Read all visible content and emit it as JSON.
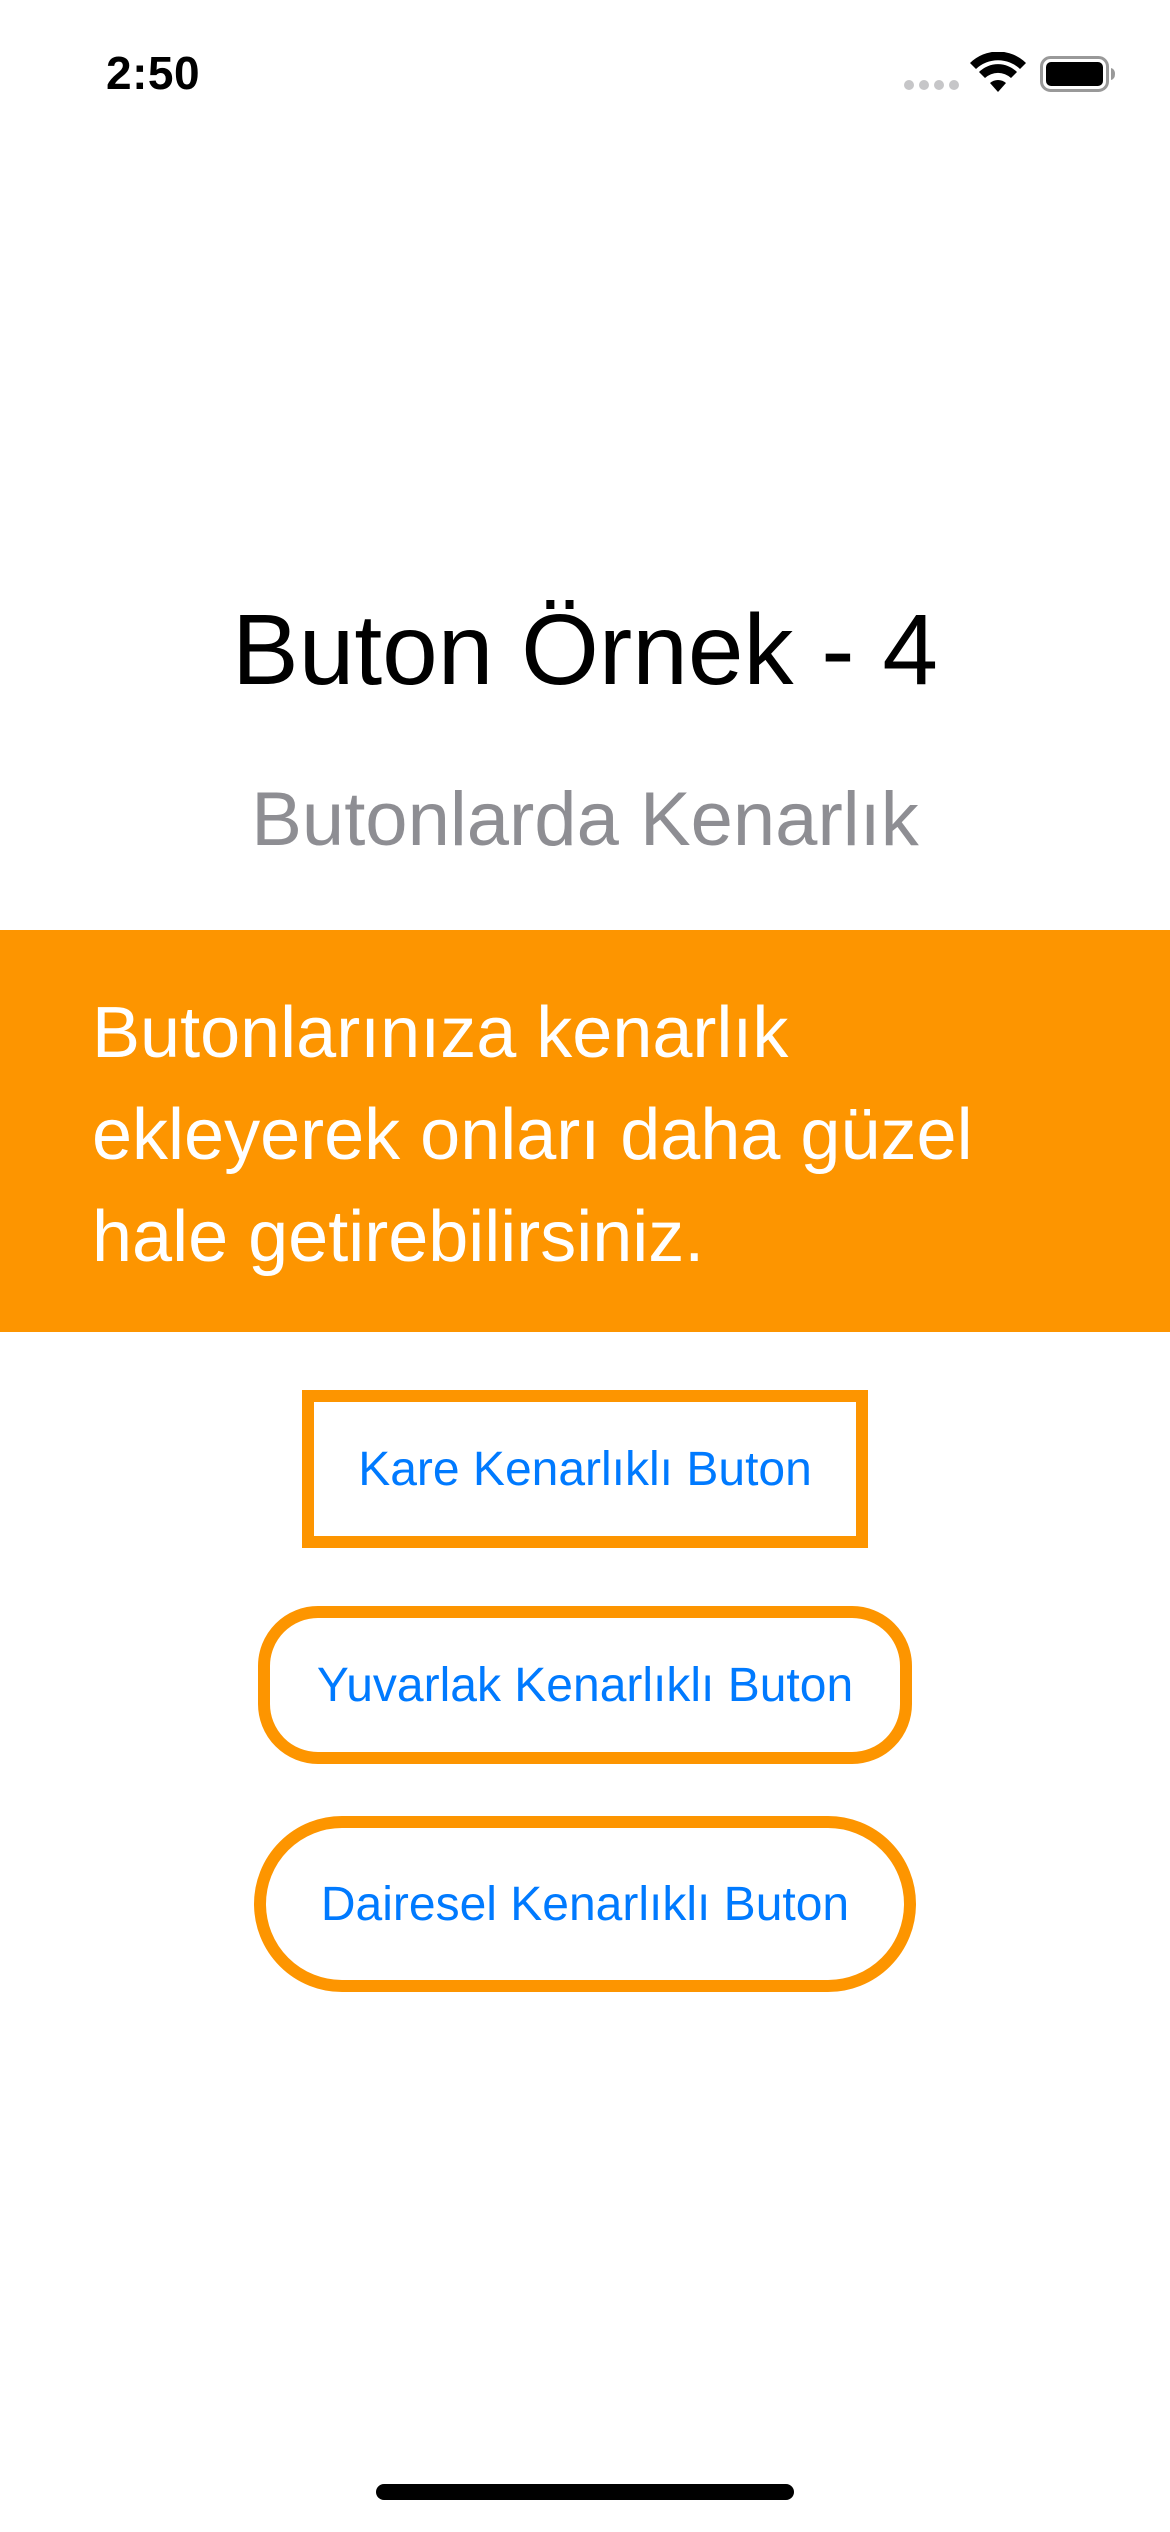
{
  "status_bar": {
    "time": "2:50"
  },
  "header": {
    "title": "Buton Örnek - 4",
    "subtitle": "Butonlarda Kenarlık"
  },
  "banner": {
    "text": "Butonlarınıza kenarlık ekleyerek onları daha güzel hale getirebilirsiniz.",
    "background_color": "#fd9500",
    "text_color": "#ffffff"
  },
  "buttons": {
    "square_label": "Kare Kenarlıklı Buton",
    "rounded_label": "Yuvarlak Kenarlıklı Buton",
    "circular_label": "Dairesel Kenarlıklı Buton",
    "border_color": "#fd9500",
    "text_color": "#007aff"
  },
  "icons": {
    "signal": "cellular-signal-icon",
    "wifi": "wifi-icon",
    "battery": "battery-icon"
  }
}
